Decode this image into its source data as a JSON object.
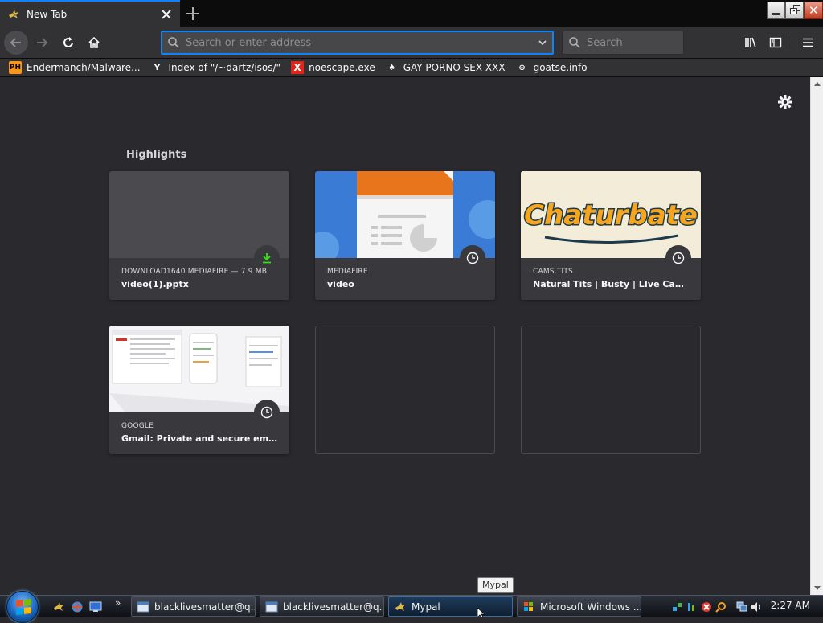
{
  "tab": {
    "title": "New Tab"
  },
  "urlbar": {
    "placeholder": "Search or enter address",
    "value": ""
  },
  "searchbar": {
    "placeholder": "Search"
  },
  "bookmarks": [
    {
      "label": "Endermanch/Malware...",
      "icon": "ph",
      "icon_text": "PH"
    },
    {
      "label": "Index of \"/~dartz/isos/\"",
      "icon": "yc",
      "icon_text": "Y"
    },
    {
      "label": "noescape.exe",
      "icon": "x",
      "icon_text": "X"
    },
    {
      "label": "GAY PORNO SEX XXX",
      "icon": "gp",
      "icon_text": "♠"
    },
    {
      "label": "goatse.info",
      "icon": "globe",
      "icon_text": "⊕"
    }
  ],
  "highlights": {
    "title": "Highlights",
    "cards": [
      {
        "source": "DOWNLOAD1640.MEDIAFIRE — 7.9 MB",
        "title": "video(1).pptx",
        "badge": "download-icon"
      },
      {
        "source": "MEDIAFIRE",
        "title": "video",
        "badge": "clock-icon"
      },
      {
        "source": "CAMS.TITS",
        "title": "Natural Tits | Busty | LIve Cams| ...",
        "badge": "clock-icon",
        "thumb_text": "Chaturbate"
      },
      {
        "source": "GOOGLE",
        "title": "Gmail: Private and secure email ...",
        "badge": "clock-icon"
      }
    ]
  },
  "taskbar": {
    "tasks": [
      {
        "label": "blacklivesmatter@q..."
      },
      {
        "label": "blacklivesmatter@q..."
      },
      {
        "label": "Mypal"
      },
      {
        "label": "Microsoft Windows ..."
      }
    ],
    "clock": "2:27 AM",
    "more": "»"
  },
  "tooltip": "Mypal",
  "colors": {
    "accent": "#0a84ff",
    "content_bg": "#2a2a2e",
    "toolbar_bg": "#323234",
    "card_bg": "#38383d"
  }
}
